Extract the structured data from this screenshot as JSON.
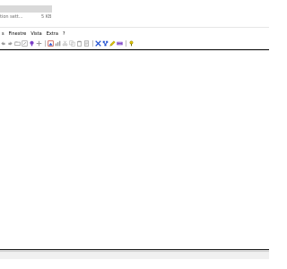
{
  "file": {
    "type_text": "tion sett...",
    "size_text": "5 KB"
  },
  "menu": {
    "items": [
      "s",
      "Finestre",
      "Vista",
      "Extra",
      "?"
    ]
  },
  "toolbar": {
    "buttons": [
      {
        "icon": "undo-arrow-icon"
      },
      {
        "icon": "redo-arrow-icon"
      },
      {
        "icon": "open-folder-icon"
      },
      {
        "icon": "resize-icon"
      },
      {
        "icon": "lightbulb-icon"
      },
      {
        "icon": "crosshair-icon"
      },
      {
        "icon": "separator"
      },
      {
        "icon": "image-icon"
      },
      {
        "icon": "chart-icon"
      },
      {
        "icon": "cut-icon"
      },
      {
        "icon": "copy-icon"
      },
      {
        "icon": "paste-icon"
      },
      {
        "icon": "doc-icon"
      },
      {
        "icon": "separator"
      },
      {
        "icon": "tools-icon"
      },
      {
        "icon": "network-icon"
      },
      {
        "icon": "pencil-icon"
      },
      {
        "icon": "keyboard-icon"
      },
      {
        "icon": "separator"
      },
      {
        "icon": "help-key-icon"
      }
    ]
  },
  "colors": {
    "frame_border": "#000000",
    "toolbar_blue": "#1f4fd1",
    "toolbar_purple": "#7a3fc8",
    "toolbar_yellow": "#e0c200",
    "toolbar_gray": "#9a9a9a"
  }
}
